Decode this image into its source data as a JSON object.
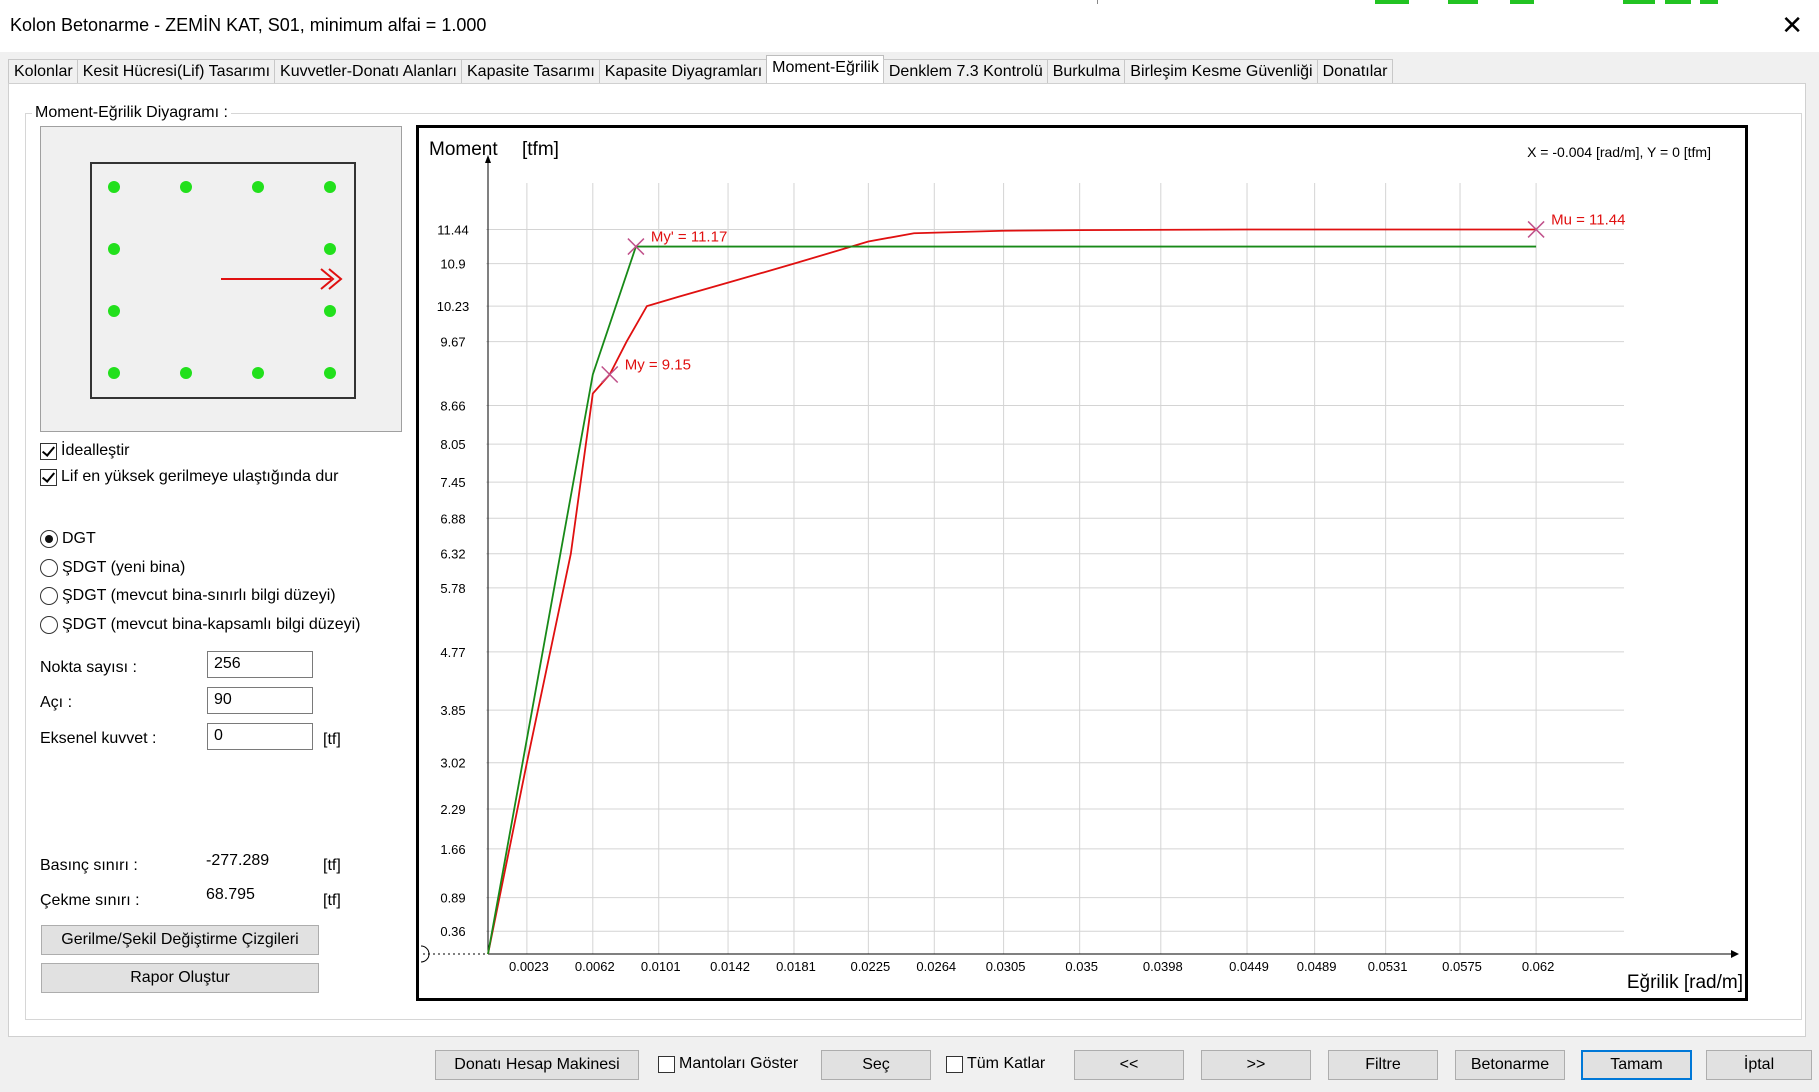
{
  "window": {
    "title": "Kolon Betonarme - ZEMİN KAT, S01, minimum alfai = 1.000"
  },
  "tabs": [
    {
      "label": "Kolonlar"
    },
    {
      "label": "Kesit Hücresi(Lif) Tasarımı"
    },
    {
      "label": "Kuvvetler-Donatı Alanları"
    },
    {
      "label": "Kapasite Tasarımı"
    },
    {
      "label": "Kapasite Diyagramları"
    },
    {
      "label": "Moment-Eğrilik",
      "active": true
    },
    {
      "label": "Denklem 7.3 Kontrolü"
    },
    {
      "label": "Burkulma"
    },
    {
      "label": "Birleşim Kesme Güvenliği"
    },
    {
      "label": "Donatılar"
    }
  ],
  "group": {
    "legend": "Moment-Eğrilik Diyagramı :"
  },
  "section": {
    "bar_color": "#22e01c",
    "arrow_color": "#e01010",
    "bar_count": 12
  },
  "options": {
    "idealize_label": "İdealleştir",
    "idealize_checked": true,
    "stop_label": "Lif en yüksek gerilmeye ulaştığında dur",
    "stop_checked": true
  },
  "radios": [
    {
      "label": "DGT",
      "selected": true
    },
    {
      "label": "ŞDGT (yeni bina)",
      "selected": false
    },
    {
      "label": "ŞDGT (mevcut bina-sınırlı bilgi düzeyi)",
      "selected": false
    },
    {
      "label": "ŞDGT (mevcut bina-kapsamlı bilgi düzeyi)",
      "selected": false
    }
  ],
  "fields": {
    "points_label": "Nokta sayısı :",
    "points_value": "256",
    "angle_label": "Açı :",
    "angle_value": "90",
    "axial_label": "Eksenel kuvvet :",
    "axial_value": "0",
    "axial_unit": "[tf]"
  },
  "limits": {
    "compression_label": "Basınç sınırı :",
    "compression_value": "-277.289",
    "compression_unit": "[tf]",
    "tension_label": "Çekme sınırı :",
    "tension_value": "68.795",
    "tension_unit": "[tf]"
  },
  "left_buttons": {
    "stress_strain": "Gerilme/Şekil Değiştirme Çizgileri",
    "report": "Rapor Oluştur"
  },
  "bottom_bar": {
    "calc": "Donatı Hesap Makinesi",
    "show_jackets": "Mantoları Göster",
    "show_jackets_checked": false,
    "select": "Seç",
    "all_floors": "Tüm Katlar",
    "all_floors_checked": false,
    "prev": "<<",
    "next": ">>",
    "filter": "Filtre",
    "concrete": "Betonarme",
    "ok": "Tamam",
    "cancel": "İptal"
  },
  "chart_data": {
    "type": "line",
    "ylabel": "Moment",
    "yunit": "[tfm]",
    "xlabel": "Eğrilik [rad/m]",
    "cursor_readout": "X = -0.004 [rad/m],  Y = 0 [tfm]",
    "xlim": [
      0,
      0.0672
    ],
    "ylim": [
      0,
      12.3
    ],
    "x_ticks": [
      "0.0023",
      "0.0062",
      "0.0101",
      "0.0142",
      "0.0181",
      "0.0225",
      "0.0264",
      "0.0305",
      "0.035",
      "0.0398",
      "0.0449",
      "0.0489",
      "0.0531",
      "0.0575",
      "0.062"
    ],
    "y_ticks": [
      "0.36",
      "0.89",
      "1.66",
      "2.29",
      "3.02",
      "3.85",
      "4.77",
      "5.78",
      "6.32",
      "6.88",
      "7.45",
      "8.05",
      "8.66",
      "9.67",
      "10.23",
      "10.9",
      "11.44"
    ],
    "grid": true,
    "series": [
      {
        "color": "#e01010",
        "x": [
          0,
          0.0023,
          0.0049,
          0.0062,
          0.0072,
          0.0082,
          0.0094,
          0.0113,
          0.0142,
          0.0181,
          0.0225,
          0.0252,
          0.0305,
          0.035,
          0.0449,
          0.0531,
          0.062
        ],
        "y": [
          0,
          3.02,
          6.32,
          8.85,
          9.15,
          9.67,
          10.23,
          10.38,
          10.6,
          10.9,
          11.25,
          11.38,
          11.42,
          11.43,
          11.44,
          11.44,
          11.44
        ]
      },
      {
        "color": "#188a18",
        "x": [
          0,
          0.0062,
          0.00875,
          0.062
        ],
        "y": [
          0,
          9.15,
          11.17,
          11.17
        ]
      }
    ],
    "annotations": [
      {
        "label": "My' = 11.17",
        "x": 0.00875,
        "y": 11.17
      },
      {
        "label": "My = 9.15",
        "x": 0.0072,
        "y": 9.15
      },
      {
        "label": "Mu = 11.44",
        "x": 0.062,
        "y": 11.44
      }
    ],
    "annotation_color": "#e01010",
    "marker_color": "#c0508a"
  }
}
